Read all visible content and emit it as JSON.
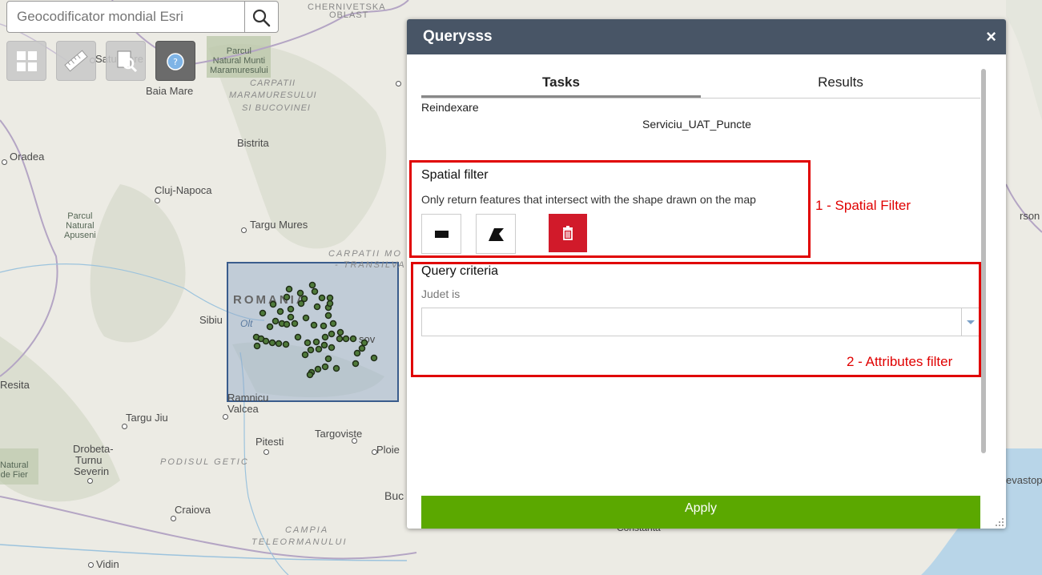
{
  "search": {
    "placeholder": "Geocodificator mondial Esri"
  },
  "map": {
    "places": [
      "CHERNIVETSKA",
      "OBLAST",
      "Satu Mare",
      "Baia Mare",
      "Oradea",
      "Bistrita",
      "Cluj-Napoca",
      "Targu Mures",
      "Sibiu",
      "Resita",
      "Targu Jiu",
      "Drobeta-",
      "Turnu",
      "Severin",
      "Craiova",
      "Pitesti",
      "Targoviste",
      "Ploie",
      "Buc",
      "Ramnicu",
      "Valcea",
      "Vidin",
      "Constanta",
      "rson",
      "evastop",
      "Olt",
      "sov"
    ],
    "regions": [
      "CARPATII",
      "MARAMURESULUI",
      "SI BUCOVINEI",
      "CARPATII MO",
      "- TRANSILVA",
      "PODISUL GETIC",
      "CAMPIA",
      "TELEORMANULUI"
    ],
    "country": "ROMANIA",
    "parks": [
      "Parcul",
      "Natural Munti",
      "Maramuresului",
      "Parcul",
      "Natural",
      "Apuseni",
      "Natural",
      "de Fier"
    ]
  },
  "panel": {
    "title": "Querysss",
    "close": "×",
    "tabs": [
      "Tasks",
      "Results"
    ],
    "task_name": "Reindexare",
    "service": "Serviciu_UAT_Puncte",
    "spatial_filter": {
      "title": "Spatial filter",
      "hint": "Only return features that intersect with the shape drawn on the map"
    },
    "query_criteria": {
      "title": "Query criteria",
      "field_label": "Judet is",
      "value": ""
    },
    "apply": "Apply"
  },
  "annotations": [
    "1 - Spatial Filter",
    "2 - Attributes filter"
  ],
  "colors": {
    "header": "#485566",
    "apply": "#5ba800",
    "trash": "#d11a2a",
    "annotation": "#e00000"
  },
  "icons": [
    "search-icon",
    "basemap-gallery-icon",
    "measurement-icon",
    "query-icon",
    "about-icon",
    "rectangle-draw-icon",
    "polygon-draw-icon",
    "trash-icon",
    "chevron-down-icon",
    "resize-grip-icon"
  ]
}
